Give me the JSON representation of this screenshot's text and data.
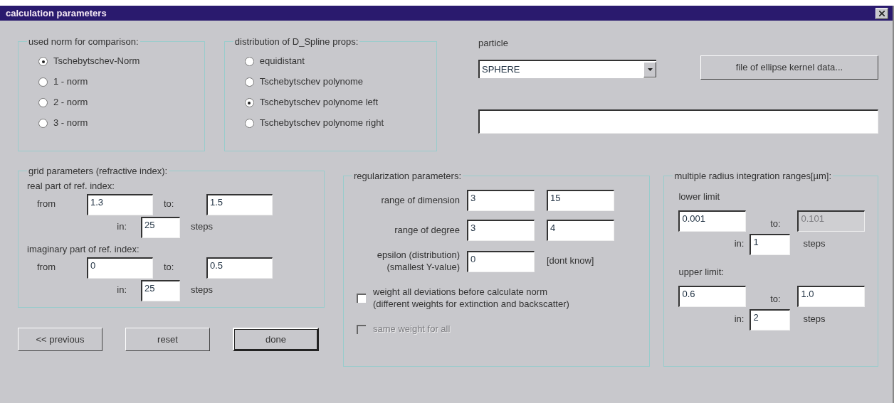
{
  "window": {
    "title": "calculation parameters"
  },
  "norm_group": {
    "title": "used norm for comparison:",
    "options": [
      {
        "label": "Tschebytschev-Norm",
        "selected": true
      },
      {
        "label": "1 - norm",
        "selected": false
      },
      {
        "label": "2 - norm",
        "selected": false
      },
      {
        "label": "3 - norm",
        "selected": false
      }
    ]
  },
  "spline_group": {
    "title": "distribution of D_Spline props:",
    "options": [
      {
        "label": "equidistant",
        "selected": false
      },
      {
        "label": "Tschebytschev polynome",
        "selected": false
      },
      {
        "label": "Tschebytschev polynome left",
        "selected": true
      },
      {
        "label": "Tschebytschev polynome right",
        "selected": false
      }
    ]
  },
  "particle": {
    "label": "particle",
    "value": "SPHERE",
    "button": "file of ellipse kernel data..."
  },
  "grid_group": {
    "title": "grid parameters (refractive index):",
    "sections": [
      {
        "title": "real part of ref. index:",
        "from_label": "from",
        "from": "1.3",
        "to_label": "to:",
        "to": "1.5",
        "in_label": "in:",
        "steps": "25",
        "steps_label": "steps"
      },
      {
        "title": "imaginary part of ref. index:",
        "from_label": "from",
        "from": "0",
        "to_label": "to:",
        "to": "0.5",
        "in_label": "in:",
        "steps": "25",
        "steps_label": "steps"
      }
    ]
  },
  "regularization": {
    "title": "regularization parameters:",
    "rows": [
      {
        "label": "range of dimension",
        "min": "3",
        "max": "15"
      },
      {
        "label": "range of degree",
        "min": "3",
        "max": "4"
      }
    ],
    "epsilon": {
      "label": "epsilon (distribution)\n(smallest Y-value)",
      "value": "0",
      "note": "[dont know]"
    },
    "checkboxes": [
      {
        "label": "weight all deviations before calculate norm\n(different weights for extinction and backscatter)",
        "checked": false,
        "disabled": false
      },
      {
        "label": "same weight for all",
        "checked": false,
        "disabled": true
      }
    ]
  },
  "radius_group": {
    "title": "multiple radius integration ranges[µm]:",
    "sections": [
      {
        "title": "lower limit",
        "from": "0.001",
        "to_label": "to:",
        "to": "0.101",
        "to_disabled": true,
        "in_label": "in:",
        "steps": "1",
        "steps_label": "steps"
      },
      {
        "title": "upper limit:",
        "from": "0.6",
        "to_label": "to:",
        "to": "1.0",
        "to_disabled": false,
        "in_label": "in:",
        "steps": "2",
        "steps_label": "steps"
      }
    ]
  },
  "buttons": [
    {
      "label": "<< previous",
      "default": false
    },
    {
      "label": "reset",
      "default": false
    },
    {
      "label": "done",
      "default": true
    }
  ]
}
